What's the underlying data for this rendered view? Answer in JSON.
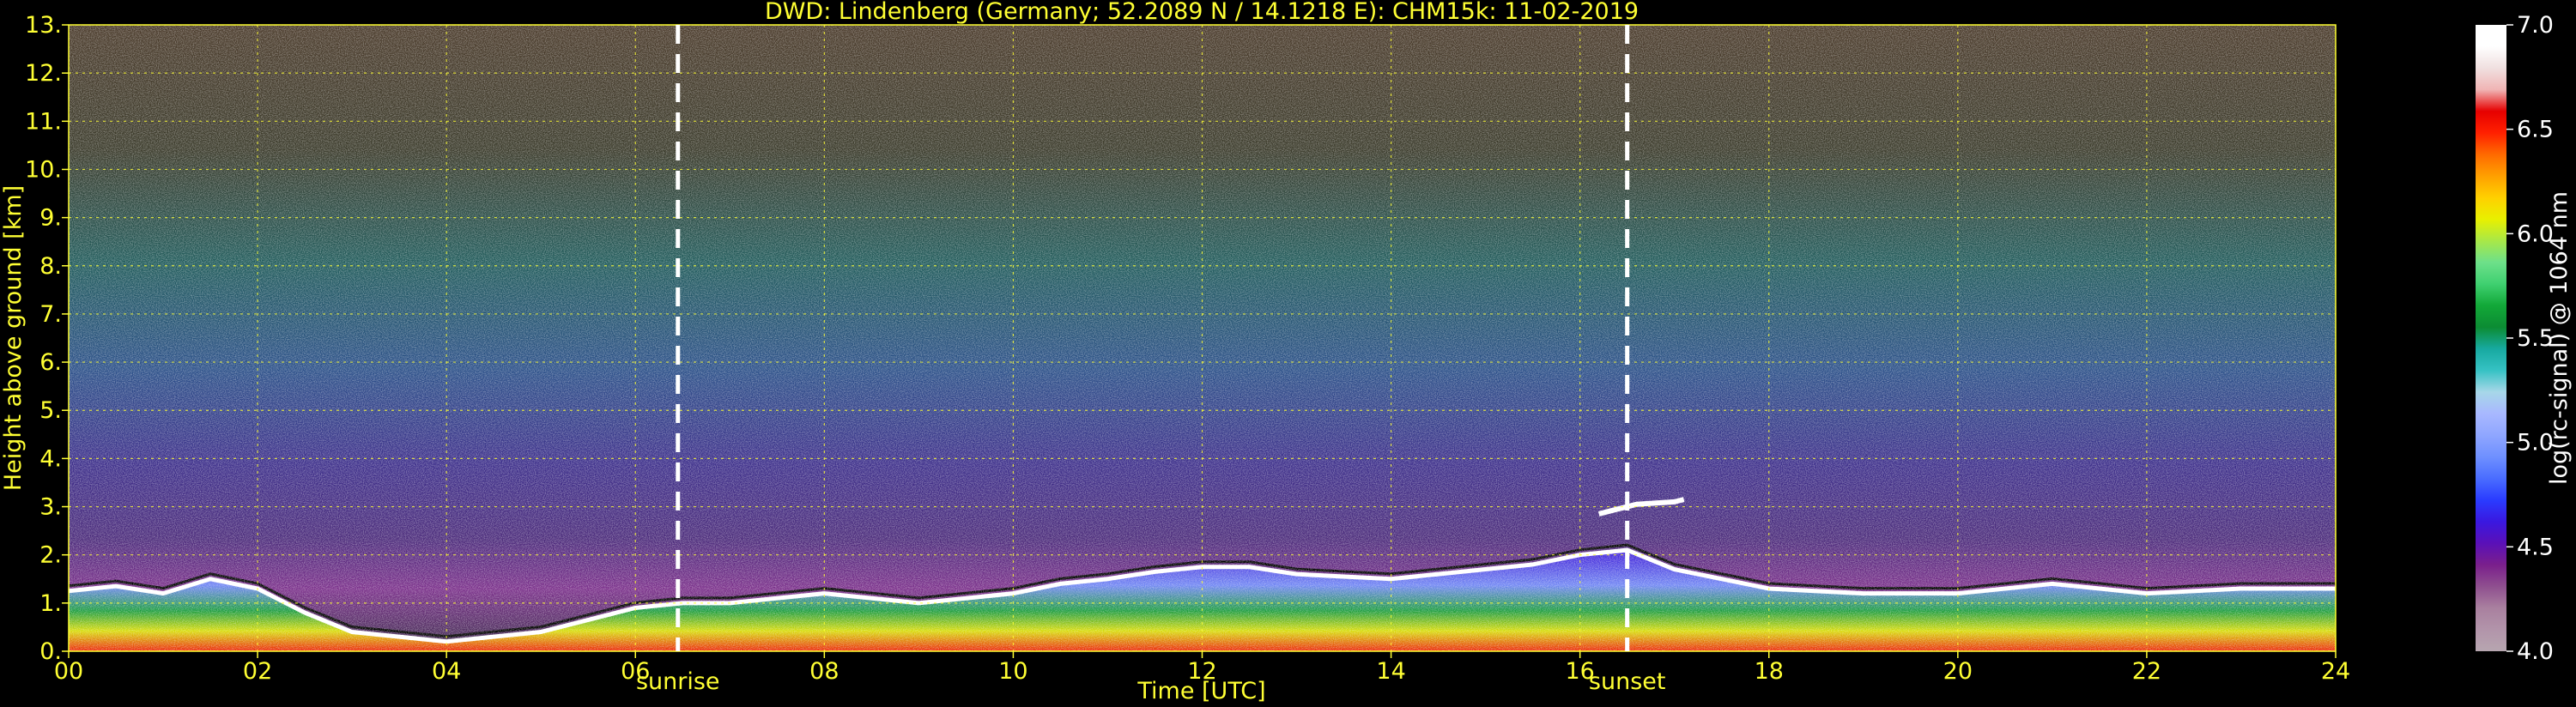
{
  "chart_data": {
    "type": "heatmap",
    "title": "DWD: Lindenberg (Germany; 52.2089 N / 14.1218 E):    CHM15k: 11-02-2019",
    "xlabel": "Time [UTC]",
    "ylabel": "Height above ground [km]",
    "xlim": [
      0,
      24
    ],
    "ylim": [
      0,
      13
    ],
    "x_ticks": [
      "00",
      "02",
      "04",
      "06",
      "08",
      "10",
      "12",
      "14",
      "16",
      "18",
      "20",
      "22",
      "24"
    ],
    "y_ticks": [
      "0.",
      "1.",
      "2.",
      "3.",
      "4.",
      "5.",
      "6.",
      "7.",
      "8.",
      "9.",
      "10.",
      "11.",
      "12.",
      "13."
    ],
    "grid": true,
    "events": [
      {
        "label": "sunrise",
        "time": 6.45
      },
      {
        "label": "sunset",
        "time": 16.5
      }
    ],
    "colorbar": {
      "label": "log(rc-signal) @ 1064 nm",
      "range": [
        4.0,
        7.0
      ],
      "ticks": [
        "4.0",
        "4.5",
        "5.0",
        "5.5",
        "6.0",
        "6.5",
        "7.0"
      ],
      "colors": [
        "#b7a6b0",
        "#b294aa",
        "#a9809f",
        "#8f4f8f",
        "#7a1f8c",
        "#5a10b8",
        "#3a18e0",
        "#2a3cff",
        "#4a6dff",
        "#6f90ff",
        "#8fa6ff",
        "#a8b8ff",
        "#a7d7e8",
        "#36c2c4",
        "#17a9a0",
        "#0c8c33",
        "#12a838",
        "#3fd070",
        "#6de08a",
        "#a8e848",
        "#e8f000",
        "#ffd000",
        "#ffa000",
        "#ff6a00",
        "#ff2000",
        "#e60000",
        "#f0b4b4",
        "#f0e0e0",
        "#ffffff",
        "#ffffff"
      ]
    },
    "cloud_base_layer": [
      [
        0.0,
        1.25
      ],
      [
        0.5,
        1.35
      ],
      [
        1.0,
        1.2
      ],
      [
        1.5,
        1.5
      ],
      [
        2.0,
        1.3
      ],
      [
        2.5,
        0.8
      ],
      [
        3.0,
        0.4
      ],
      [
        4.0,
        0.2
      ],
      [
        5.0,
        0.4
      ],
      [
        6.0,
        0.9
      ],
      [
        6.5,
        1.0
      ],
      [
        7.0,
        1.0
      ],
      [
        8.0,
        1.2
      ],
      [
        9.0,
        1.0
      ],
      [
        10.0,
        1.2
      ],
      [
        10.5,
        1.4
      ],
      [
        11.0,
        1.5
      ],
      [
        11.5,
        1.65
      ],
      [
        12.0,
        1.75
      ],
      [
        12.5,
        1.75
      ],
      [
        13.0,
        1.6
      ],
      [
        13.5,
        1.55
      ],
      [
        14.0,
        1.5
      ],
      [
        14.5,
        1.6
      ],
      [
        15.0,
        1.7
      ],
      [
        15.5,
        1.8
      ],
      [
        16.0,
        2.0
      ],
      [
        16.5,
        2.1
      ],
      [
        17.0,
        1.7
      ],
      [
        18.0,
        1.3
      ],
      [
        19.0,
        1.2
      ],
      [
        20.0,
        1.2
      ],
      [
        21.0,
        1.4
      ],
      [
        22.0,
        1.2
      ],
      [
        23.0,
        1.3
      ],
      [
        24.0,
        1.3
      ]
    ],
    "upper_cloud_layer": [
      [
        16.2,
        2.85
      ],
      [
        16.6,
        3.05
      ],
      [
        17.0,
        3.1
      ],
      [
        17.1,
        3.15
      ]
    ]
  }
}
